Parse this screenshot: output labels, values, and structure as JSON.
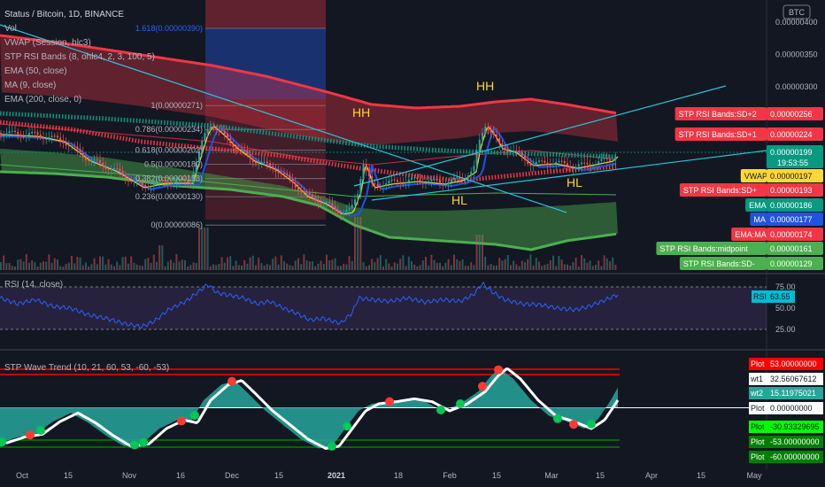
{
  "header": {
    "symbol_line": "Status / Bitcoin, 1D, BINANCE",
    "indicators": [
      "Vol",
      "VWAP (Session, hlc3)",
      "STP RSI Bands (8, ohlc4, 2, 3, 100, 5)",
      "EMA (50, close)",
      "MA (9, close)",
      "EMA (200, close, 0)"
    ]
  },
  "price_axis": {
    "currency": "BTC",
    "ticks": [
      {
        "label": "0.00000400",
        "v": 400
      },
      {
        "label": "0.00000350",
        "v": 350
      },
      {
        "label": "0.00000300",
        "v": 300
      }
    ],
    "badges": [
      {
        "label": "STP RSI Bands:SD+2",
        "value": "0.00000256",
        "v": 256,
        "color": "#f23645"
      },
      {
        "label": "STP RSI Bands:SD+1",
        "value": "0.00000224",
        "v": 224,
        "color": "#f23645"
      },
      {
        "label": "",
        "value": "0.00000199",
        "extra": "19:53:55",
        "v": 199,
        "color": "#089981"
      },
      {
        "label": "VWAP",
        "value": "0.00000197",
        "v": 197,
        "color": "#fdd835",
        "text": "#131722"
      },
      {
        "label": "STP RSI Bands:SD+",
        "value": "0.00000193",
        "v": 193,
        "color": "#f23645"
      },
      {
        "label": "EMA",
        "value": "0.00000186",
        "v": 186,
        "color": "#089981"
      },
      {
        "label": "MA",
        "value": "0.00000177",
        "v": 177,
        "color": "#1e53e5"
      },
      {
        "label": "EMA:MA",
        "value": "0.00000174",
        "v": 174,
        "color": "#f23645"
      },
      {
        "label": "STP RSI Bands:midpoint",
        "value": "0.00000161",
        "v": 161,
        "color": "#4caf50"
      },
      {
        "label": "STP RSI Bands:SD-",
        "value": "0.00000129",
        "v": 129,
        "color": "#4caf50"
      }
    ]
  },
  "fib_levels": [
    {
      "label": "1.618(0.00000390)",
      "v": 390
    },
    {
      "label": "1(0.00000271)",
      "v": 271
    },
    {
      "label": "0.786(0.00000234)",
      "v": 234
    },
    {
      "label": "0.618(0.00000202)",
      "v": 202
    },
    {
      "label": "0.5(0.00000180)",
      "v": 180
    },
    {
      "label": "0.382(0.00000158)",
      "v": 158
    },
    {
      "label": "0.236(0.00000130)",
      "v": 130
    },
    {
      "label": "0(0.00000086)",
      "v": 86
    }
  ],
  "annotations": [
    "HH",
    "HH",
    "HL",
    "HL"
  ],
  "rsi": {
    "title": "RSI (14, close)",
    "ticks": [
      {
        "label": "75.00",
        "v": 75
      },
      {
        "label": "50.00",
        "v": 50
      },
      {
        "label": "25.00",
        "v": 25
      }
    ],
    "badge_label": "RSI",
    "badge_value": "63.55",
    "badge_color": "#00bcd4"
  },
  "wave": {
    "title": "STP Wave Trend (10, 21, 60, 53, -60, -53)",
    "badges": [
      {
        "label": "Plot",
        "value": "53.00000000",
        "v": 53,
        "color": "#ff0000",
        "text": "#ffffff"
      },
      {
        "label": "wt1",
        "value": "32.56067612",
        "v": 32.56,
        "color": "#ffffff",
        "text": "#131722"
      },
      {
        "label": "wt2",
        "value": "15.11975021",
        "v": 15.12,
        "color": "#26a69a",
        "text": "#ffffff"
      },
      {
        "label": "Plot",
        "value": "0.00000000",
        "v": 0,
        "color": "#ffffff",
        "text": "#131722"
      },
      {
        "label": "Plot",
        "value": "-30.93329695",
        "v": -30.93,
        "color": "#00ff00",
        "text": "#131722"
      },
      {
        "label": "Plot",
        "value": "-53.00000000",
        "v": -53,
        "color": "#008000",
        "text": "#ffffff"
      },
      {
        "label": "Plot",
        "value": "-60.00000000",
        "v": -60,
        "color": "#008000",
        "text": "#ffffff"
      }
    ]
  },
  "time_axis": [
    "Oct",
    "15",
    "Nov",
    "16",
    "Dec",
    "15",
    "2021",
    "18",
    "Feb",
    "15",
    "Mar",
    "15",
    "Apr",
    "15",
    "May"
  ],
  "chart_data": {
    "type": "candlestick",
    "title": "Status / Bitcoin, 1D, BINANCE",
    "y_unit": "BTC (x1e-8 satoshi)",
    "price_series_approx": [
      {
        "date": "Oct",
        "close": 210
      },
      {
        "date": "Nov",
        "close": 150
      },
      {
        "date": "Nov 23",
        "close": 245
      },
      {
        "date": "Dec",
        "close": 180
      },
      {
        "date": "Dec 28",
        "close": 96
      },
      {
        "date": "Jan 6",
        "close": 175
      },
      {
        "date": "Feb 10",
        "close": 238
      },
      {
        "date": "Feb 15",
        "close": 190
      },
      {
        "date": "Mar 15",
        "close": 184
      },
      {
        "date": "Mar 21",
        "close": 199
      }
    ],
    "rsi_last": 63.55,
    "rsi_levels": [
      75,
      25
    ],
    "wave_trend_last": {
      "wt1": 32.56,
      "wt2": 15.12
    }
  },
  "colors": {
    "bg": "#131722",
    "red_band": "#f23645",
    "green_band": "#4caf50",
    "ema200": "#089981",
    "ma9": "#1e53e5",
    "vwap": "#fdd835",
    "trendline": "#26c6da",
    "rsi_line": "#2962ff",
    "wave_fill": "#26a69a"
  }
}
